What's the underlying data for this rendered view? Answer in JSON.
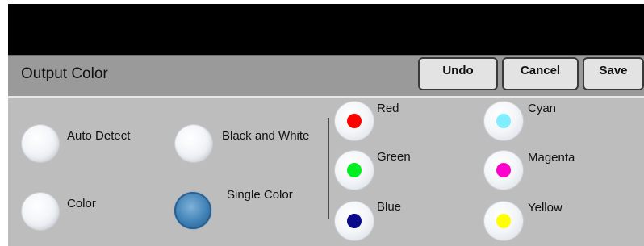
{
  "header": {
    "title": "Output Color"
  },
  "toolbar": {
    "undo": "Undo",
    "cancel": "Cancel",
    "save": "Save"
  },
  "modes": [
    {
      "label": "Auto Detect",
      "selected": false
    },
    {
      "label": "Black and White",
      "selected": false
    },
    {
      "label": "Color",
      "selected": false
    },
    {
      "label": "Single Color",
      "selected": true
    }
  ],
  "colors": [
    {
      "label": "Red",
      "swatch": "#ff0000"
    },
    {
      "label": "Cyan",
      "swatch": "#7fefff"
    },
    {
      "label": "Green",
      "swatch": "#00ee22"
    },
    {
      "label": "Magenta",
      "swatch": "#ff00cc"
    },
    {
      "label": "Blue",
      "swatch": "#0a0a8a"
    },
    {
      "label": "Yellow",
      "swatch": "#ffff00"
    }
  ],
  "palette": {
    "selected_mode": "#3d7fb5"
  }
}
